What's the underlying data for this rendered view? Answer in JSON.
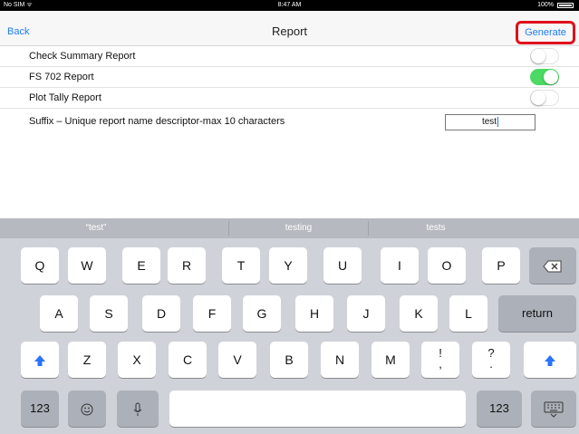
{
  "status_bar": {
    "carrier": "No SIM ᯤ",
    "time": "8:47 AM",
    "battery": "100%"
  },
  "nav": {
    "back": "Back",
    "title": "Report",
    "generate": "Generate"
  },
  "rows": [
    {
      "label": "Check Summary Report",
      "toggle": "off"
    },
    {
      "label": "FS 702 Report",
      "toggle": "on"
    },
    {
      "label": "Plot Tally Report",
      "toggle": "off"
    }
  ],
  "suffix": {
    "label": "Suffix – Unique report name descriptor-max 10 characters",
    "value": "test"
  },
  "keyboard": {
    "suggestions": [
      "“test”",
      "testing",
      "tests"
    ],
    "row1": [
      "Q",
      "W",
      "E",
      "R",
      "T",
      "Y",
      "U",
      "I",
      "O",
      "P"
    ],
    "row2": [
      "A",
      "S",
      "D",
      "F",
      "G",
      "H",
      "J",
      "K",
      "L"
    ],
    "row3": [
      "Z",
      "X",
      "C",
      "V",
      "B",
      "N",
      "M"
    ],
    "punct1_top": "!",
    "punct1_bottom": ",",
    "punct2_top": "?",
    "punct2_bottom": ".",
    "return": "return",
    "numbers_left": "123",
    "numbers_right": "123",
    "icons": {
      "backspace": "backspace-icon",
      "shift": "shift-icon",
      "emoji": "emoji-icon",
      "mic": "microphone-icon",
      "hide": "keyboard-hide-icon"
    }
  }
}
